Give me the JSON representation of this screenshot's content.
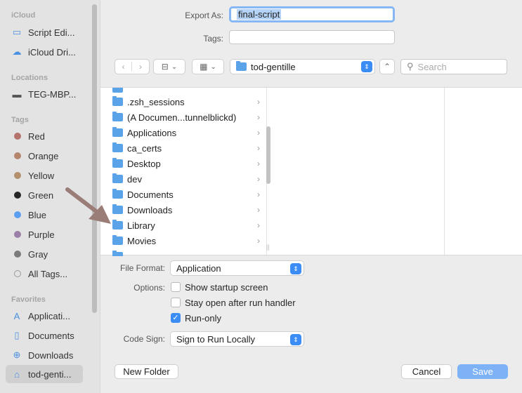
{
  "sidebar": {
    "sections": {
      "icloud": "iCloud",
      "locations": "Locations",
      "tags": "Tags",
      "favorites": "Favorites"
    },
    "icloud_items": [
      {
        "label": "Script Edi...",
        "icon": "folder-icon"
      },
      {
        "label": "iCloud Dri...",
        "icon": "cloud-icon"
      }
    ],
    "location_items": [
      {
        "label": "TEG-MBP...",
        "icon": "laptop-icon"
      }
    ],
    "tag_items": [
      {
        "label": "Red",
        "color": "#b5736d"
      },
      {
        "label": "Orange",
        "color": "#b5866d"
      },
      {
        "label": "Yellow",
        "color": "#b5906d"
      },
      {
        "label": "Green",
        "color": "#262626"
      },
      {
        "label": "Blue",
        "color": "#5b9ff0"
      },
      {
        "label": "Purple",
        "color": "#9c7fa6"
      },
      {
        "label": "Gray",
        "color": "#7b7b7b"
      },
      {
        "label": "All Tags...",
        "color": "#999999"
      }
    ],
    "favorite_items": [
      {
        "label": "Applicati...",
        "icon": "applications-icon"
      },
      {
        "label": "Documents",
        "icon": "document-icon"
      },
      {
        "label": "Downloads",
        "icon": "download-icon"
      },
      {
        "label": "tod-genti...",
        "icon": "home-icon",
        "selected": true
      }
    ]
  },
  "header": {
    "export_label": "Export As:",
    "export_value": "final-script",
    "tags_label": "Tags:",
    "tags_value": ""
  },
  "toolbar": {
    "location": "tod-gentille",
    "search_placeholder": "Search"
  },
  "browser": {
    "files": [
      {
        "name": ".zsh_sessions"
      },
      {
        "name": "(A Documen...tunnelblickd)"
      },
      {
        "name": "Applications"
      },
      {
        "name": "ca_certs"
      },
      {
        "name": "Desktop"
      },
      {
        "name": "dev"
      },
      {
        "name": "Documents"
      },
      {
        "name": "Downloads"
      },
      {
        "name": "Library"
      },
      {
        "name": "Movies"
      }
    ]
  },
  "options": {
    "file_format_label": "File Format:",
    "file_format_value": "Application",
    "options_label": "Options:",
    "checkboxes": [
      {
        "label": "Show startup screen",
        "checked": false
      },
      {
        "label": "Stay open after run handler",
        "checked": false
      },
      {
        "label": "Run-only",
        "checked": true
      }
    ],
    "code_sign_label": "Code Sign:",
    "code_sign_value": "Sign to Run Locally"
  },
  "footer": {
    "new_folder": "New Folder",
    "cancel": "Cancel",
    "save": "Save"
  },
  "colors": {
    "accent": "#3b8df5",
    "arrow": "#9b7d78"
  }
}
